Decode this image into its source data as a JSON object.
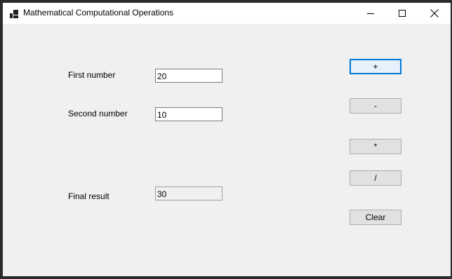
{
  "window": {
    "title": "Mathematical Computational Operations",
    "icon": "app-window-icon"
  },
  "caption_buttons": {
    "minimize_icon": "minimize-icon",
    "maximize_icon": "maximize-icon",
    "close_icon": "close-icon"
  },
  "form": {
    "first_number_label": "First number",
    "first_number_value": "20",
    "second_number_label": "Second number",
    "second_number_value": "10",
    "result_label": "Final result",
    "result_value": "30"
  },
  "buttons": {
    "add_label": "+",
    "subtract_label": "-",
    "multiply_label": "*",
    "divide_label": "/",
    "clear_label": "Clear"
  },
  "colors": {
    "focus_accent": "#0078d7",
    "window_background": "#f0f0f0",
    "button_face": "#e1e1e1"
  }
}
